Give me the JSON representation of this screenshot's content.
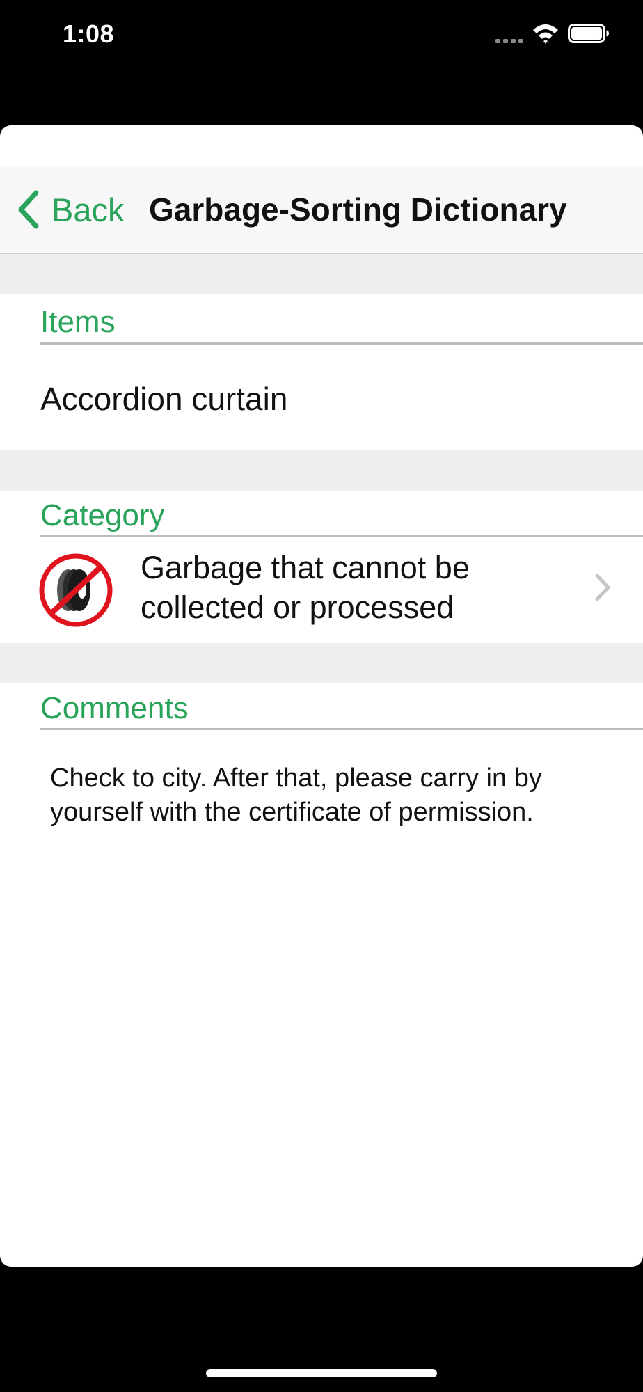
{
  "status_bar": {
    "time": "1:08",
    "icons": [
      "cellular-signal-icon",
      "wifi-icon",
      "battery-icon"
    ]
  },
  "nav": {
    "back_label": "Back",
    "title": "Garbage-Sorting Dictionary"
  },
  "sections": {
    "items": {
      "header": "Items",
      "value": "Accordion curtain"
    },
    "category": {
      "header": "Category",
      "label": "Garbage that cannot be collected or processed",
      "icon": "prohibited-tire-icon"
    },
    "comments": {
      "header": "Comments",
      "text": "Check to city. After that, please carry in by yourself with the certificate of permission."
    }
  },
  "colors": {
    "accent": "#2aa35b",
    "prohibited_red": "#e0141e",
    "group_background": "#efefef",
    "nav_background": "#f7f7f7"
  }
}
